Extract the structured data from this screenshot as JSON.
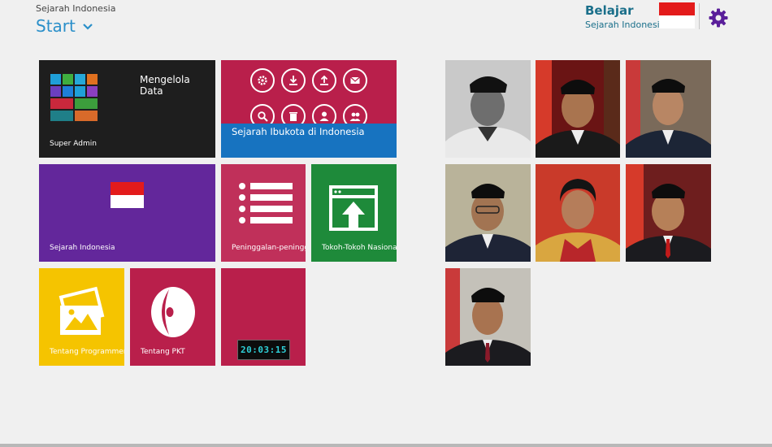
{
  "header": {
    "app_subtitle": "Sejarah Indonesia",
    "start_label": "Start",
    "user_name": "Belajar",
    "user_sub": "Sejarah Indonesia"
  },
  "tiles": {
    "admin": {
      "title": "Mengelola Data",
      "label": "Super Admin"
    },
    "ibukota": {
      "label": "Sejarah Ibukota di Indonesia"
    },
    "sejarah": {
      "label": "Sejarah Indonesia"
    },
    "peninggalan": {
      "label": "Peninggalan-peninggalan"
    },
    "tokoh": {
      "label": "Tokoh-Tokoh Nasional"
    },
    "programmer": {
      "label": "Tentang Programmer"
    },
    "pkt": {
      "label": "Tentang PKT"
    },
    "clock": {
      "time": "20:03:15"
    }
  },
  "icons": {
    "admin_grid": [
      "store-icon",
      "mail-icon",
      "photos-icon",
      "people-icon",
      "calendar-icon",
      "browser-icon",
      "explorer-icon",
      "maps-icon",
      "video-icon",
      "xbox-icon",
      "music-icon",
      "messaging-icon"
    ],
    "ibukota": [
      "settings-icon",
      "download-icon",
      "upload-icon",
      "mail-icon",
      "search-icon",
      "delete-icon",
      "user-icon",
      "users-icon"
    ]
  },
  "colors": {
    "accent": "#2a8fc9",
    "admin_tile": "#1e1e1e",
    "ibukota_tile": "#b91f4b",
    "ibukota_band": "#1773c0",
    "sejarah_tile": "#63279b",
    "peninggalan_tile": "#c0305a",
    "tokoh_tile": "#1e8a3a",
    "programmer_tile": "#f5c400",
    "pkt_tile": "#b91f4b",
    "clock_tile": "#b91f4b",
    "gear": "#5a1f9a"
  },
  "portraits": [
    "president-1",
    "president-2",
    "president-3",
    "president-4",
    "president-5",
    "president-6",
    "president-7"
  ]
}
